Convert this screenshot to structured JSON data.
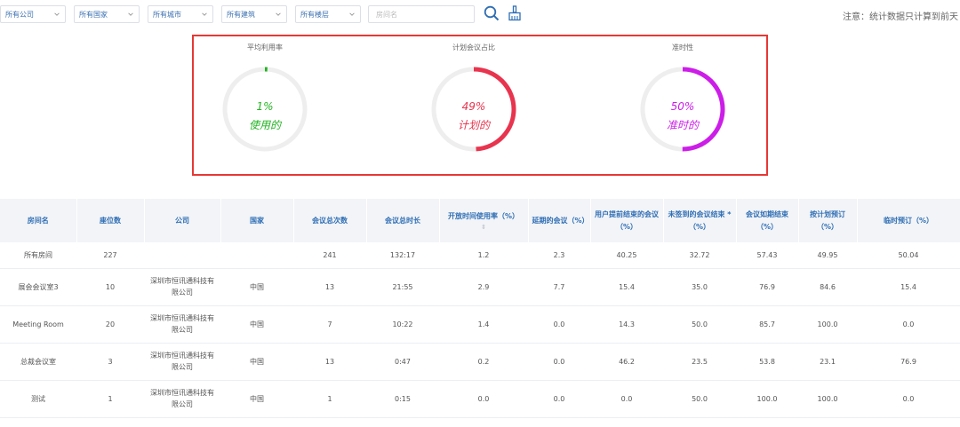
{
  "filters": [
    {
      "label": "所有公司"
    },
    {
      "label": "所有国家"
    },
    {
      "label": "所有城市"
    },
    {
      "label": "所有建筑"
    },
    {
      "label": "所有楼层"
    }
  ],
  "search": {
    "placeholder": "房间名"
  },
  "icons": {
    "search": "search-icon",
    "clear": "broom-icon"
  },
  "note": "注意：统计数据只计算到前天",
  "stats": [
    {
      "title": "平均利用率",
      "value": "1%",
      "label": "使用的",
      "percent": 1,
      "color": "#21b321"
    },
    {
      "title": "计划会议占比",
      "value": "49%",
      "label": "计划的",
      "percent": 49,
      "color": "#e8344e"
    },
    {
      "title": "准时性",
      "value": "50%",
      "label": "准时的",
      "percent": 50,
      "color": "#cc1ee8"
    }
  ],
  "colors": {
    "accent": "#2f6eb5",
    "panel_border": "#e53935",
    "track": "#eeeeee"
  },
  "table": {
    "headers": [
      "房间名",
      "座位数",
      "公司",
      "国家",
      "会议总次数",
      "会议总时长",
      "开放时间使用率（%）",
      "延期的会议（%）",
      "用户提前结束的会议（%）",
      "未签到的会议结束 *（%）",
      "会议如期结束（%）",
      "按计划预订（%）",
      "临时预订（%）"
    ],
    "sort_icon": "⇕",
    "rows": [
      [
        "所有房间",
        "227",
        "",
        "",
        "241",
        "132:17",
        "1.2",
        "2.3",
        "40.25",
        "32.72",
        "57.43",
        "49.95",
        "50.04"
      ],
      [
        "展会会议室3",
        "10",
        "深圳市恒讯通科技有限公司",
        "中国",
        "13",
        "21:55",
        "2.9",
        "7.7",
        "15.4",
        "35.0",
        "76.9",
        "84.6",
        "15.4"
      ],
      [
        "Meeting Room",
        "20",
        "深圳市恒讯通科技有限公司",
        "中国",
        "7",
        "10:22",
        "1.4",
        "0.0",
        "14.3",
        "50.0",
        "85.7",
        "100.0",
        "0.0"
      ],
      [
        "总裁会议室",
        "3",
        "深圳市恒讯通科技有限公司",
        "中国",
        "13",
        "0:47",
        "0.2",
        "0.0",
        "46.2",
        "23.5",
        "53.8",
        "23.1",
        "76.9"
      ],
      [
        "测试",
        "1",
        "深圳市恒讯通科技有限公司",
        "中国",
        "1",
        "0:15",
        "0.0",
        "0.0",
        "0.0",
        "50.0",
        "100.0",
        "100.0",
        "0.0"
      ]
    ]
  }
}
